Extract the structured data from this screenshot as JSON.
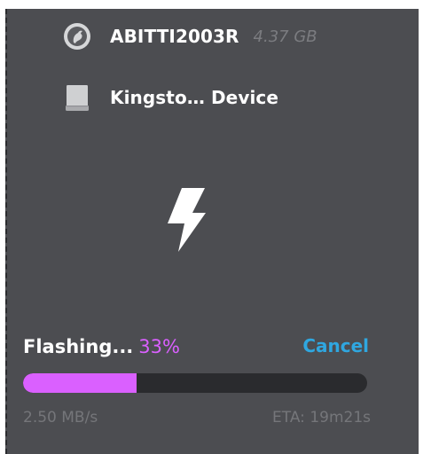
{
  "source": {
    "icon": "image-disc-icon",
    "name": "ABITTI2003R",
    "size": "4.37 GB"
  },
  "target": {
    "icon": "drive-icon",
    "name": "Kingsto… Device"
  },
  "flash_icon": "lightning-bolt-icon",
  "progress": {
    "status_label": "Flashing...",
    "percent_text": "33%",
    "percent_value": 33,
    "speed": "2.50 MB/s",
    "eta": "ETA: 19m21s",
    "cancel_label": "Cancel"
  },
  "colors": {
    "panel_bg": "#4c4d51",
    "accent_progress": "#da60ff",
    "cancel_link": "#2fa7e0",
    "track": "#2a2b2e"
  }
}
